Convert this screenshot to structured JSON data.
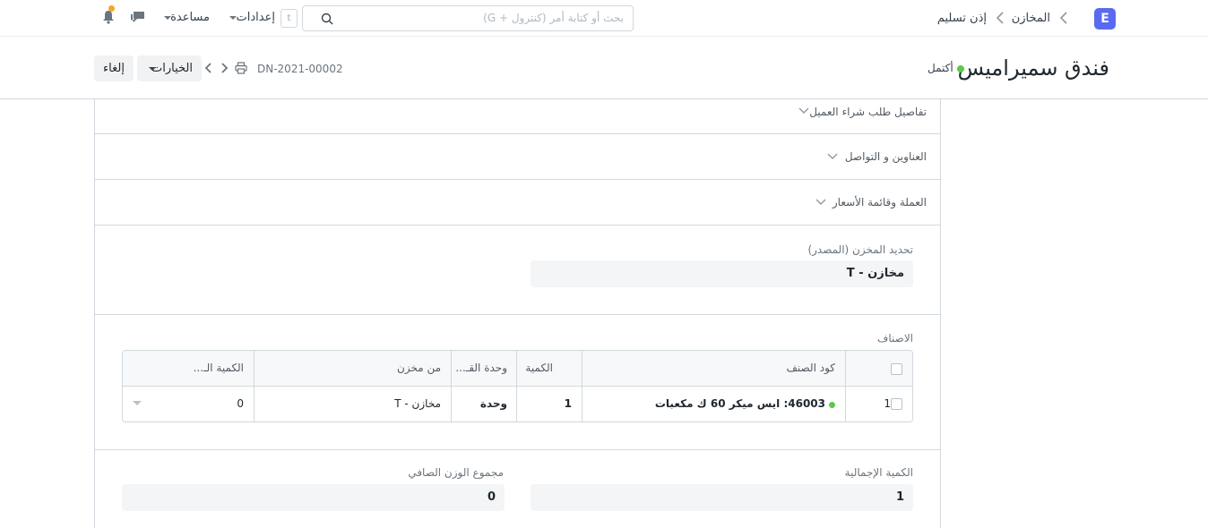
{
  "navbar": {
    "logo_letter": "E",
    "breadcrumbs": [
      "المخازن",
      "إذن تسليم"
    ],
    "search_placeholder": "بحث أو كتابة أمر (كنترول + G)",
    "shortcut_key": "t",
    "settings_label": "إعدادات",
    "help_label": "مساعدة",
    "accent_color": "#5a6af0"
  },
  "header": {
    "title": "فندق سميراميس",
    "status": "أكتمل",
    "status_color": "#5cc84c",
    "doc_name": "DN-2021-00002",
    "options_label": "الخيارات",
    "cancel_label": "إلغاء"
  },
  "sections": {
    "customer_po": "تفاصيل طلب شراء العميل",
    "address": "العناوين و التواصل",
    "currency": "العملة وقائمة الأسعار"
  },
  "warehouse": {
    "label": "تحديد المخزن (المصدر)",
    "value": "مخازن - T"
  },
  "items": {
    "label": "الاصناف",
    "columns": [
      "كود الصنف",
      "الكمية",
      "وحدة القـ...",
      "من مخزن",
      "الكمية الـ..."
    ],
    "rows": [
      {
        "idx": "1",
        "item_code": "46003: ايس ميكر 60 ك مكعبات",
        "qty": "1",
        "uom": "وحدة",
        "warehouse": "مخازن - T",
        "last_qty": "0"
      }
    ]
  },
  "totals": {
    "total_qty_label": "الكمية الإجمالية",
    "total_qty": "1",
    "net_weight_label": "مجموع الوزن الصافي",
    "net_weight": "0"
  }
}
